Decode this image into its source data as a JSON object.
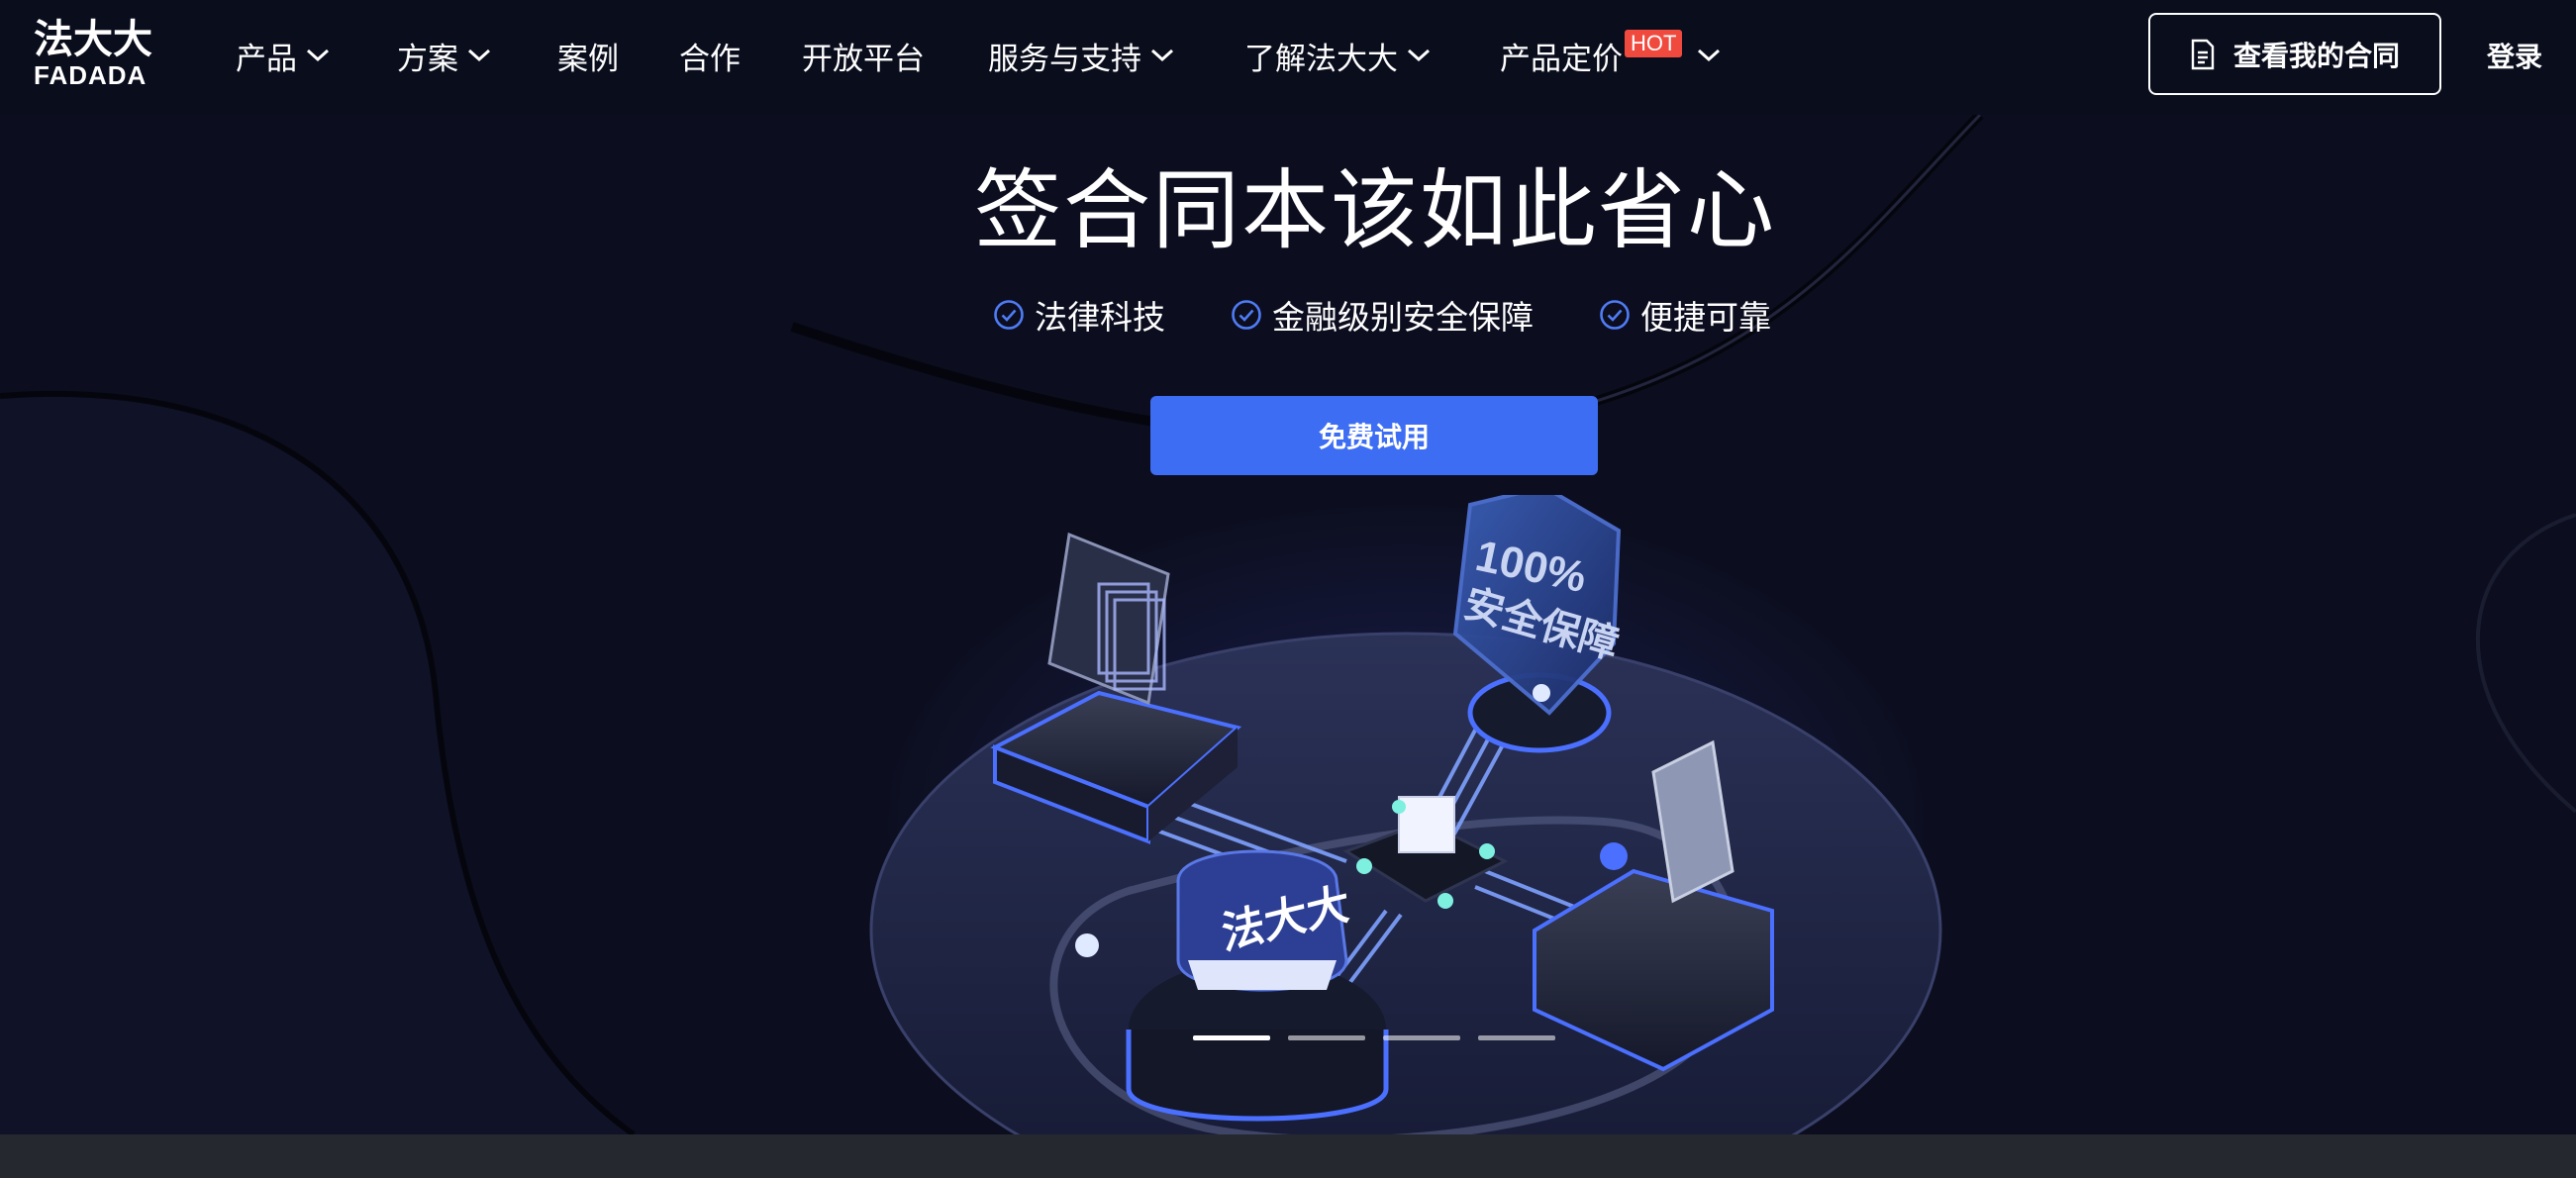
{
  "logo": {
    "cn": "法大大",
    "en": "FADADA"
  },
  "nav": {
    "items": [
      {
        "label": "产品",
        "has_dropdown": true
      },
      {
        "label": "方案",
        "has_dropdown": true
      },
      {
        "label": "案例",
        "has_dropdown": false
      },
      {
        "label": "合作",
        "has_dropdown": false
      },
      {
        "label": "开放平台",
        "has_dropdown": false
      },
      {
        "label": "服务与支持",
        "has_dropdown": true
      },
      {
        "label": "了解法大大",
        "has_dropdown": true
      },
      {
        "label": "产品定价",
        "badge": "HOT",
        "has_dropdown": true
      }
    ],
    "contract_button": "查看我的合同",
    "login": "登录"
  },
  "hero": {
    "title": "签合同本该如此省心",
    "features": [
      "法律科技",
      "金融级别安全保障",
      "便捷可靠"
    ],
    "cta": "免费试用"
  },
  "illustration": {
    "shield_text": "100%",
    "shield_subtext": "安全保障",
    "base_logo": "法大大"
  },
  "carousel": {
    "slides": 4,
    "active": 1
  },
  "colors": {
    "background": "#0c0e1f",
    "nav_background": "#0a0d1c",
    "accent": "#3d6df2",
    "hot_badge": "#f04a3e",
    "check": "#4f7cf5"
  },
  "icons": {
    "dropdown": "chevron-down-icon",
    "contract": "document-icon",
    "feature": "check-circle-icon"
  }
}
